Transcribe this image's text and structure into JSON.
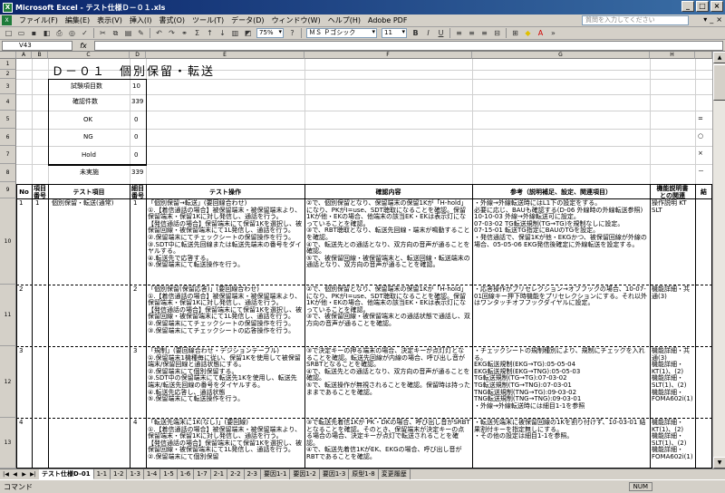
{
  "window": {
    "title": "Microsoft Excel - テスト仕様Ｄ－０１.xls",
    "btn_min": "_",
    "btn_max": "□",
    "btn_close": "×"
  },
  "menu": {
    "items": [
      "ファイル(F)",
      "編集(E)",
      "表示(V)",
      "挿入(I)",
      "書式(O)",
      "ツール(T)",
      "データ(D)",
      "ウィンドウ(W)",
      "ヘルプ(H)",
      "Adobe PDF"
    ],
    "help_placeholder": "質問を入力してください",
    "right_controls": [
      "▾",
      "_",
      "×"
    ]
  },
  "toolbar": {
    "zoom": "75%",
    "font": "ＭＳ Ｐゴシック",
    "size": "11",
    "bold": "B",
    "italic": "I",
    "underline": "U"
  },
  "formula": {
    "cell_ref": "V43",
    "fx": "fx"
  },
  "columns": [
    "A",
    "B",
    "C",
    "D",
    "E",
    "F",
    "G",
    "H"
  ],
  "rows": [
    "1",
    "2",
    "3",
    "4",
    "5",
    "6",
    "7",
    "8",
    "9",
    "10",
    "11",
    "12",
    "13",
    "14"
  ],
  "sheet": {
    "title": "Ｄ－０１　個別保留・転送",
    "summary": [
      {
        "label": "試験項目数",
        "value": "10"
      },
      {
        "label": "確認件数",
        "value": "339"
      },
      {
        "label": "OK",
        "value": "0"
      },
      {
        "label": "NG",
        "value": "0"
      },
      {
        "label": "Hold",
        "value": "0"
      },
      {
        "label": "未実施",
        "value": "339"
      }
    ],
    "side_marks": [
      "=",
      "○",
      "×",
      "－"
    ],
    "headers": {
      "no": "No",
      "item_no": "項目\n番号",
      "test_item": "テスト項目",
      "op_no": "細目\n番号",
      "test_op": "テスト操作",
      "confirm": "確認内容",
      "reference": "参考（説明補足、設定、関連項目）",
      "manual": "機能説明書\nとの関連",
      "result": "結"
    },
    "rows": [
      {
        "no": "1",
        "item_no": "1",
        "test_item": "個別保留・転送(通常)",
        "op_no": "1",
        "op": "「個別保留→転送」(要回線合わせ)\n①.【着信通話の場合】被保留端末・被保留端末より、保留端末・保留1Kに対し発信し、通話を行う。\n【発信通話の場合】保留端末にて保留1Kを選択し、被保留回線・被保留端末にて1L発信し、通話を行う。\n②.保留端末にてチェックシートの保留操作を行う。\n③.SDT中に転送先回線または転送先端末の番号をダイヤルする。\n④.転送先で応答する。\n⑤.保留端末にて転送操作を行う。",
        "confirm": "②で、個別保留となり、保留端末の保留1Kが「H-hold」になり、PKがI=use、SDT聴取になることを確認。保留1Kが他・EKの場合、他端末の該当EK・EKは表示灯になっていることを確認。\n③で、RBT聴取となり、転送先回線・端末が鳴動することを確認。\n④で、転送先との通話となり、双方向の音声が通ることを確認。\n⑤で、被保留回線・被保留端末と、転送回線・転送端末の通話となり、双方向の音声が通ることを確認。",
        "ref": "・外線→外線転送時にはL1下の設定をする。\n必要に応じ、BAUも確認する(D-06 外線時の外線転送参照)\n10-10-03 外線→外線転送可に設定。\n07-03-02 TG転送規制(TG→TG)を規制なしに設定。\n07-15-01 転送TG指定にBAUのTGを設定。\n・発信通話で、保留1Kが他・EKGかつ、被保留回線が外線の場合、05-05-06 EKG発信後確定に外線転送を設定する。",
        "manual": "操作説明 KT\nSLT"
      },
      {
        "no": "2",
        "item_no": "",
        "test_item": "",
        "op_no": "2",
        "op": "「個別保留(保留応答)」(要回線合わせ)\n①.【着信通話の場合】被保留端末・被保留端末より、保留端末・保留1Kに対し発信し、通話を行う。\n【発信通話の場合】保留端末にて保留1Kを選択し、被保留回線・被保留端末にて1L発信し、通話を行う。\n②.保留端末にてチェックシートの保留操作を行う。\n③.保留端末にてチェックシートの応答操作を行う。",
        "confirm": "②で、個別保留となり、保留端末の保留1Kが「H-hold」になり、PKがI=use、SDT聴取になることを確認。保留1Kが他・EKの場合、他端末の該当EK・EKは表示灯になっていることを確認。\n③で、被保留回線・被保留端末との通話状態で通話し、双方向の音声が通ることを確認。",
        "ref": "・応答操作がプリセレクション→オフフックの場合、10-07-01回線キー押下時機能をプリセレクションにする。それ以外はワンタッチオフフックダイヤルに設定。",
        "manual": "機能詳細・共通(3)"
      },
      {
        "no": "3",
        "item_no": "",
        "test_item": "",
        "op_no": "3",
        "op": "「規制」(要回線合わせ・デジションテーブル)\n①.保留端末1機種毎に従い、保留1Kを使用して被保留端末/保留回線と通話状態にする。\n②.保留端末にて個別保留する。\n③.SDT中の保留端末にて転送先1Kを使用し、転送先端末/転送先回線の番号をダイヤルする。\n④.転送先応答し、通話状態\n⑤.保留端末にて転送操作を行う。",
        "confirm": "③で決定キーの押る端末の場合、決定キーが点灯灯となることを確認。転送先回線が内線の場合、呼び出し音がSRBTとなることを確認。\n④で、転送先との通話となり、双方向の音声が通ることを確認。\n⑤で、転送操作が無視されることを確認。保留時は持ったままであることを確認。",
        "ref": "・チェックシートの規制種別により、規制にチェックを入れる。\nEKG転送規制(EKG→TG):05-05-04\nEKG転送規制(EKG→TNG):05-05-03\nTG転送規制(TG→TG):07-03-02\nTG転送規制(TG→TNG):07-03-01\nTNG転送規制(TNG→TG):09-03-02\nTNG転送規制(TNG→TNG):09-03-01\n・外線→外線転送時には細目1-1を参照",
        "manual": "機能詳細・共通(3)\n機能詳細・KT(1)、(2)\n機能詳細・SLT(1)、(2)\n機能詳細・FOMA602i(1)"
      },
      {
        "no": "4",
        "item_no": "",
        "test_item": "",
        "op_no": "4",
        "op": "「転送先端末に1K(なし)」(要回線)\n①.【着信通話の場合】被保留端末・被保留端末より、保留端末・保留1Kに対し発信し、通話を行う。\n【発信通話の場合】保留端末にて保留1Kを選択し、被保留回線・被保留端末にて1L発信し、通話を行う。\n②.保留端末にて個別保留",
        "confirm": "③で転送先着信1Kが PK・DKの場合、呼び出し音がSRBTとなることを確認。そのとき、保留端末が決定キーの点る場合の場合、決定キーが点灯で転送されることを確認。\n④で、転送先着信1KがEK、EKGの場合、呼び出し音がRBTであることを確認。",
        "ref": "・転送先端末に被保留回線の1Kを割り付けず、10-03-01 結果割付キーを指定無しにする。\n・その他の設定は細目1-1を参照。",
        "manual": "機能詳細・KT(1)、(2)\n機能詳細・SLT(1)、(2)\n機能詳細・FOMA602i(1)"
      }
    ]
  },
  "tabs": {
    "nav": [
      "|◀",
      "◀",
      "▶",
      "▶|"
    ],
    "items": [
      "テスト仕様D-01",
      "1-1",
      "1-2",
      "1-3",
      "1-4",
      "1-5",
      "1-6",
      "1-7",
      "2-1",
      "2-2",
      "2-3",
      "要因1-1",
      "要因1-2",
      "要因1-3",
      "原型1-8",
      "変更履歴"
    ]
  },
  "status": {
    "left": "コマンド",
    "num": "NUM"
  }
}
